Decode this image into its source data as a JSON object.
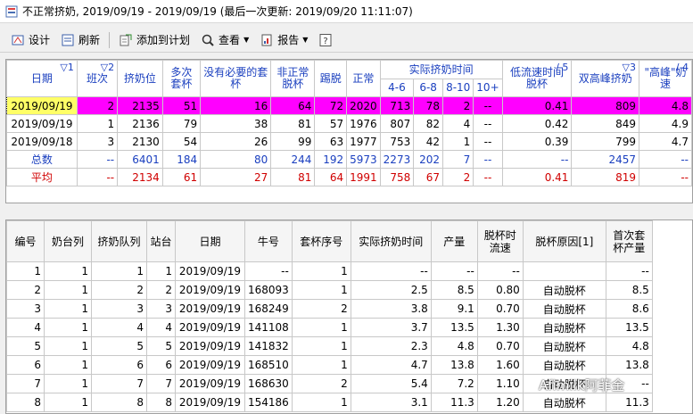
{
  "window": {
    "title": "不正常挤奶, 2019/09/19 - 2019/09/19 (最后一次更新: 2019/09/20 11:11:07)"
  },
  "toolbar": {
    "design": "设计",
    "refresh": "刷新",
    "add_to_plan": "添加到计划",
    "view": "查看",
    "report": "报告"
  },
  "summary": {
    "headers": {
      "date": "日期",
      "shift": "班次",
      "milk_pos": "挤奶位",
      "extra_cups": "多次套杯",
      "unneeded_cups": "没有必要的套杯",
      "abnormal_off": "非正常脱杯",
      "kick_off": "踢脱",
      "normal": "正常",
      "actual_time_group": "实际挤奶时间",
      "t4_6": "4-6",
      "t6_8": "6-8",
      "t8_10": "8-10",
      "t10p": "10+",
      "low_flow": "低流速时间脱杯",
      "double_peak": "双高峰挤奶",
      "high_peak": "\"高峰\"奶速"
    },
    "sort_marks": {
      "date": "▽1",
      "shift": "▽2",
      "low_flow": "/ 5",
      "double_peak": "▽3",
      "high_peak": "/ 4"
    },
    "rows": [
      [
        "2019/09/19",
        "2",
        "2135",
        "51",
        "16",
        "64",
        "72",
        "2020",
        "713",
        "78",
        "2",
        "--",
        "0.41",
        "809",
        "4.8"
      ],
      [
        "2019/09/19",
        "1",
        "2136",
        "79",
        "38",
        "81",
        "57",
        "1976",
        "807",
        "82",
        "4",
        "--",
        "0.42",
        "849",
        "4.9"
      ],
      [
        "2019/09/18",
        "3",
        "2130",
        "54",
        "26",
        "99",
        "63",
        "1977",
        "753",
        "42",
        "1",
        "--",
        "0.39",
        "799",
        "4.7"
      ]
    ],
    "total": [
      "总数",
      "--",
      "6401",
      "184",
      "80",
      "244",
      "192",
      "5973",
      "2273",
      "202",
      "7",
      "--",
      "--",
      "2457",
      "--"
    ],
    "average": [
      "平均",
      "--",
      "2134",
      "61",
      "27",
      "81",
      "64",
      "1991",
      "758",
      "67",
      "2",
      "--",
      "0.41",
      "819",
      "--"
    ]
  },
  "detail": {
    "headers": [
      "编号",
      "奶台列",
      "挤奶队列",
      "站台",
      "日期",
      "牛号",
      "套杯序号",
      "实际挤奶时间",
      "产量",
      "脱杯时流速",
      "脱杯原因[1]",
      "首次套杯产量"
    ],
    "rows": [
      [
        "1",
        "1",
        "1",
        "1",
        "2019/09/19",
        "--",
        "1",
        "--",
        "--",
        "--",
        "",
        "--"
      ],
      [
        "2",
        "1",
        "2",
        "2",
        "2019/09/19",
        "168093",
        "1",
        "2.5",
        "8.5",
        "0.80",
        "自动脱杯",
        "8.5"
      ],
      [
        "3",
        "1",
        "3",
        "3",
        "2019/09/19",
        "168249",
        "2",
        "3.8",
        "9.1",
        "0.70",
        "自动脱杯",
        "8.6"
      ],
      [
        "4",
        "1",
        "4",
        "4",
        "2019/09/19",
        "141108",
        "1",
        "3.7",
        "13.5",
        "1.30",
        "自动脱杯",
        "13.5"
      ],
      [
        "5",
        "1",
        "5",
        "5",
        "2019/09/19",
        "141832",
        "1",
        "2.3",
        "4.8",
        "0.70",
        "自动脱杯",
        "4.8"
      ],
      [
        "6",
        "1",
        "6",
        "6",
        "2019/09/19",
        "168510",
        "1",
        "4.7",
        "13.8",
        "1.60",
        "自动脱杯",
        "13.8"
      ],
      [
        "7",
        "1",
        "7",
        "7",
        "2019/09/19",
        "168630",
        "2",
        "5.4",
        "7.2",
        "1.10",
        "自动脱杯",
        "--"
      ],
      [
        "8",
        "1",
        "8",
        "8",
        "2019/09/19",
        "154186",
        "1",
        "3.1",
        "11.3",
        "1.20",
        "自动脱杯",
        "11.3"
      ]
    ]
  },
  "watermark": "Afimilk阿菲金"
}
